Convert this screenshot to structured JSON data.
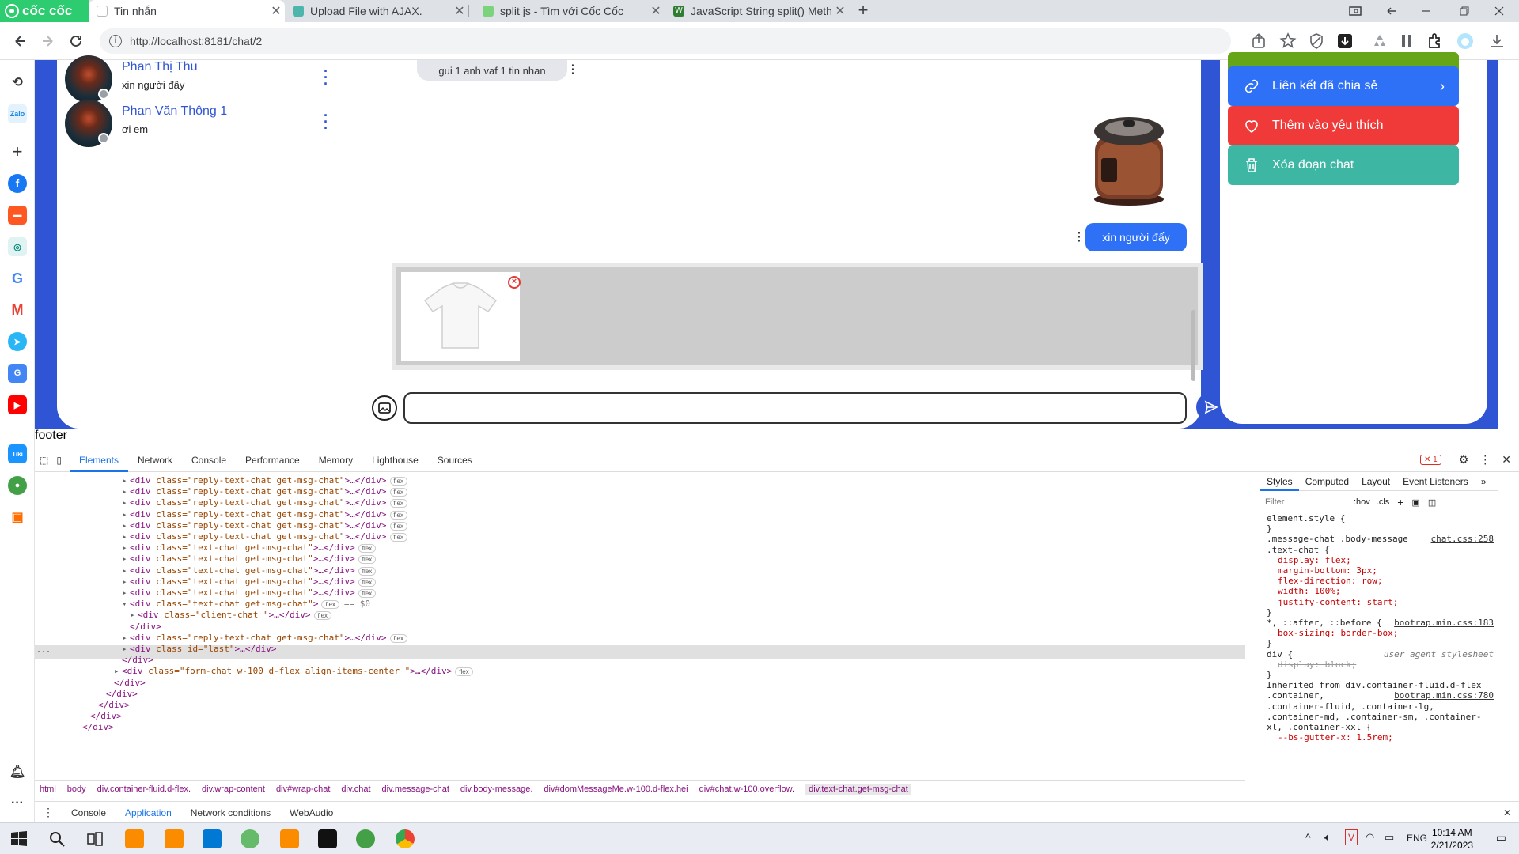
{
  "browser": {
    "brand": "cốc cốc",
    "tabs": [
      {
        "title": "Tin nhắn",
        "active": true
      },
      {
        "title": "Upload File with AJAX.",
        "active": false
      },
      {
        "title": "split js - Tìm với Cốc Cốc",
        "active": false
      },
      {
        "title": "JavaScript String split() Meth",
        "active": false
      }
    ],
    "url": "http://localhost:8181/chat/2"
  },
  "chat": {
    "conversations": [
      {
        "name": "Phan Thị Thu",
        "last_message": "xin người đấy"
      },
      {
        "name": "Phan Văn Thông 1",
        "last_message": "ơi em"
      }
    ],
    "messages": {
      "received_text": "gui 1 anh vaf 1 tin nhan",
      "sent_text": "xin người đấy"
    },
    "composer": {
      "placeholder": ""
    }
  },
  "actions": [
    {
      "label": "Liên kết đã chia sẻ",
      "color": "#2f71f6"
    },
    {
      "label": "Thêm vào yêu thích",
      "color": "#f03a3a"
    },
    {
      "label": "Xóa đoạn chat",
      "color": "#3db7a4"
    }
  ],
  "colors": {
    "primary": "#2f55d4",
    "green_action": "#66a517"
  },
  "footer_text": "footer",
  "devtools": {
    "tabs": [
      "Elements",
      "Network",
      "Console",
      "Performance",
      "Memory",
      "Lighthouse",
      "Sources"
    ],
    "error_count": "1",
    "dom_lines": [
      {
        "indent": 1,
        "tag": "div",
        "attrs": " class=\"reply-text-chat get-msg-chat\"",
        "tail": ">…</div>",
        "badge": "flex"
      },
      {
        "indent": 1,
        "tag": "div",
        "attrs": " class=\"reply-text-chat get-msg-chat\"",
        "tail": ">…</div>",
        "badge": "flex"
      },
      {
        "indent": 1,
        "tag": "div",
        "attrs": " class=\"reply-text-chat get-msg-chat\"",
        "tail": ">…</div>",
        "badge": "flex"
      },
      {
        "indent": 1,
        "tag": "div",
        "attrs": " class=\"reply-text-chat get-msg-chat\"",
        "tail": ">…</div>",
        "badge": "flex"
      },
      {
        "indent": 1,
        "tag": "div",
        "attrs": " class=\"reply-text-chat get-msg-chat\"",
        "tail": ">…</div>",
        "badge": "flex"
      },
      {
        "indent": 1,
        "tag": "div",
        "attrs": " class=\"reply-text-chat get-msg-chat\"",
        "tail": ">…</div>",
        "badge": "flex"
      },
      {
        "indent": 1,
        "tag": "div",
        "attrs": " class=\"text-chat get-msg-chat\"",
        "tail": ">…</div>",
        "badge": "flex"
      },
      {
        "indent": 1,
        "tag": "div",
        "attrs": " class=\"text-chat get-msg-chat\"",
        "tail": ">…</div>",
        "badge": "flex"
      },
      {
        "indent": 1,
        "tag": "div",
        "attrs": " class=\"text-chat get-msg-chat\"",
        "tail": ">…</div>",
        "badge": "flex"
      },
      {
        "indent": 1,
        "tag": "div",
        "attrs": " class=\"text-chat get-msg-chat\"",
        "tail": ">…</div>",
        "badge": "flex"
      },
      {
        "indent": 1,
        "tag": "div",
        "attrs": " class=\"text-chat get-msg-chat\"",
        "tail": ">…</div>",
        "badge": "flex"
      },
      {
        "indent": 1,
        "tag": "div",
        "attrs": " class=\"text-chat get-msg-chat\"",
        "tail": ">",
        "badge": "flex",
        "selected": true,
        "extra": "== $0"
      },
      {
        "indent": 2,
        "tag": "div",
        "attrs": " class=\"client-chat \"",
        "tail": ">…</div>",
        "badge": "flex"
      },
      {
        "indent": 1,
        "tag": "/div",
        "attrs": "",
        "tail": ">",
        "badge": ""
      },
      {
        "indent": 1,
        "tag": "div",
        "attrs": " class=\"reply-text-chat get-msg-chat\"",
        "tail": ">…</div>",
        "badge": "flex"
      },
      {
        "indent": 1,
        "tag": "div",
        "attrs": " class id=\"last\"",
        "tail": ">…</div>",
        "badge": ""
      },
      {
        "indent": 0,
        "tag": "/div",
        "attrs": "",
        "tail": ">",
        "badge": ""
      },
      {
        "indent": 0,
        "tag": "div",
        "attrs": " class=\"form-chat w-100 d-flex align-items-center \"",
        "tail": ">…</div>",
        "badge": "flex"
      },
      {
        "indent": -1,
        "tag": "/div",
        "attrs": "",
        "tail": ">",
        "badge": ""
      },
      {
        "indent": -2,
        "tag": "/div",
        "attrs": "",
        "tail": ">",
        "badge": ""
      },
      {
        "indent": -3,
        "tag": "/div",
        "attrs": "",
        "tail": ">",
        "badge": ""
      },
      {
        "indent": -4,
        "tag": "/div",
        "attrs": "",
        "tail": ">",
        "badge": ""
      },
      {
        "indent": -5,
        "tag": "/div",
        "attrs": "",
        "tail": ">",
        "badge": ""
      }
    ],
    "breadcrumbs": [
      "html",
      "body",
      "div.container-fluid.d-flex.",
      "div.wrap-content",
      "div#wrap-chat",
      "div.chat",
      "div.message-chat",
      "div.body-message.",
      "div#domMessageMe.w-100.d-flex.hei",
      "div#chat.w-100.overflow.",
      "div.text-chat.get-msg-chat"
    ],
    "styles_tabs": [
      "Styles",
      "Computed",
      "Layout",
      "Event Listeners"
    ],
    "filter_placeholder": "Filter",
    "hov": ":hov",
    "cls": ".cls",
    "style_lines": [
      "element.style {",
      "}",
      ".message-chat .body-message",
      ".text-chat {",
      "display: flex;",
      "margin-bottom: 3px;",
      "flex-direction: row;",
      "width: 100%;",
      "justify-content: start;",
      "}",
      "*, ::after, ::before {",
      "box-sizing: border-box;",
      "}",
      "div {",
      "display: block;",
      "}",
      "Inherited from div.container-fluid.d-flex",
      ".container,",
      ".container-fluid, .container-lg,",
      ".container-md, .container-sm, .container-",
      "xl, .container-xxl {",
      "--bs-gutter-x: 1.5rem;"
    ],
    "style_sources": [
      "chat.css:258",
      "bootrap.min.css:183",
      "user agent stylesheet",
      "bootrap.min.css:780"
    ],
    "drawer_tabs": [
      "Console",
      "Application",
      "Network conditions",
      "WebAudio"
    ]
  },
  "taskbar": {
    "language": "ENG",
    "time": "10:14 AM",
    "date": "2/21/2023"
  }
}
